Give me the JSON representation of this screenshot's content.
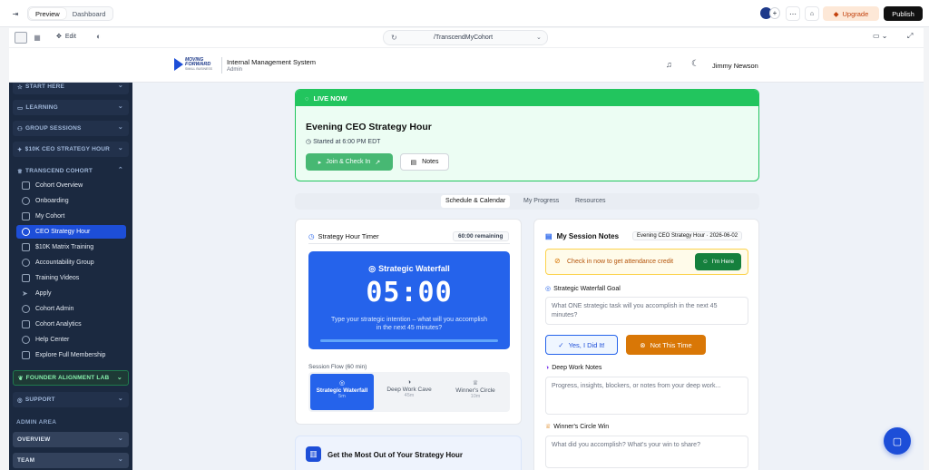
{
  "editor": {
    "tabs": [
      "Preview",
      "Dashboard"
    ],
    "active_tab": "Preview",
    "upgrade_label": "Upgrade",
    "publish_label": "Publish",
    "edit_label": "Edit",
    "url": "/TranscendMyCohort"
  },
  "header": {
    "logo_line1": "MOVING",
    "logo_line2": "FORWARD",
    "logo_line3": "SMALL BUSINESS",
    "title": "Internal Management System",
    "role": "Admin",
    "user_name": "Jimmy Newson"
  },
  "sidebar": {
    "sections": {
      "start": "START HERE",
      "learning": "LEARNING",
      "group": "GROUP SESSIONS",
      "ceo": "$10K CEO STRATEGY HOUR",
      "cohort": "TRANSCEND COHORT",
      "founder": "FOUNDER ALIGNMENT LAB",
      "support": "SUPPORT",
      "overview": "OVERVIEW",
      "team": "TEAM"
    },
    "admin_area": "ADMIN AREA",
    "items": [
      "Cohort Overview",
      "Onboarding",
      "My Cohort",
      "CEO Strategy Hour",
      "$10K Matrix Training",
      "Accountability Group",
      "Training Videos",
      "Apply",
      "Cohort Admin",
      "Cohort Analytics",
      "Help Center",
      "Explore Full Membership"
    ]
  },
  "live": {
    "badge": "LIVE NOW",
    "title": "Evening CEO Strategy Hour",
    "started": "Started at 6:00 PM EDT",
    "join_label": "Join & Check In",
    "notes_label": "Notes"
  },
  "tabs": [
    "Schedule & Calendar",
    "My Progress",
    "Resources"
  ],
  "timer": {
    "heading": "Strategy Hour Timer",
    "remaining": "60:00 remaining",
    "phase_title": "Strategic Waterfall",
    "time": "05:00",
    "prompt": "Type your strategic intention – what will you accomplish in the next 45 minutes?",
    "progress": 0,
    "flow_label": "Session Flow (60 min)",
    "phases": [
      {
        "name": "Strategic Waterfall",
        "dur": "5m"
      },
      {
        "name": "Deep Work Cave",
        "dur": "45m"
      },
      {
        "name": "Winner's Circle",
        "dur": "10m"
      }
    ]
  },
  "notes": {
    "heading": "My Session Notes",
    "session_tag": "Evening CEO Strategy Hour · 2026-06-02",
    "alert": "Check in now to get attendance credit",
    "im_here": "I'm Here",
    "goal_label": "Strategic Waterfall Goal",
    "goal_placeholder": "What ONE strategic task will you accomplish in the next 45 minutes?",
    "yes_label": "Yes, I Did It!",
    "not_label": "Not This Time",
    "deep_label": "Deep Work Notes",
    "deep_placeholder": "Progress, insights, blockers, or notes from your deep work...",
    "win_label": "Winner's Circle Win",
    "win_placeholder": "What did you accomplish? What's your win to share?"
  },
  "tips": {
    "heading": "Get the Most Out of Your Strategy Hour"
  },
  "colors": {
    "green": "#22c55e",
    "blue": "#2563eb",
    "orange": "#d97706",
    "sidebar": "#1b2940"
  }
}
